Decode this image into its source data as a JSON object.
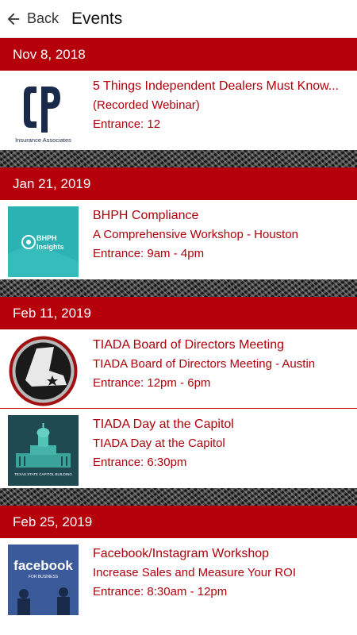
{
  "app_bar": {
    "back_label": "Back",
    "title": "Events"
  },
  "groups": [
    {
      "date": "Nov 8, 2018",
      "events": [
        {
          "title": "5 Things Independent Dealers Must Know...",
          "subtitle": "(Recorded Webinar)",
          "entrance": "Entrance: 12",
          "logo_text": "Insurance Associates"
        }
      ]
    },
    {
      "date": "Jan 21, 2019",
      "events": [
        {
          "title": "BHPH Compliance",
          "subtitle": "A Comprehensive Workshop - Houston",
          "entrance": "Entrance: 9am - 4pm",
          "logo_text_1": "BHPH",
          "logo_text_2": "Insights"
        }
      ]
    },
    {
      "date": "Feb 11, 2019",
      "events": [
        {
          "title": "TIADA Board of Directors Meeting",
          "subtitle": "TIADA Board of Directors Meeting - Austin",
          "entrance": "Entrance: 12pm - 6pm"
        },
        {
          "title": "TIADA Day at the Capitol",
          "subtitle": "TIADA Day at the Capitol",
          "entrance": "Entrance: 6:30pm",
          "logo_text": "TEXAS STATE CAPITOL BUILDING"
        }
      ]
    },
    {
      "date": "Feb 25, 2019",
      "events": [
        {
          "title": "Facebook/Instagram Workshop",
          "subtitle": "Increase Sales and Measure Your ROI",
          "entrance": "Entrance: 8:30am - 12pm",
          "logo_text_1": "facebook",
          "logo_text_2": "FOR BUSINESS"
        }
      ]
    }
  ],
  "colors": {
    "header_red": "#b5000c",
    "text_red": "#b0000b"
  }
}
